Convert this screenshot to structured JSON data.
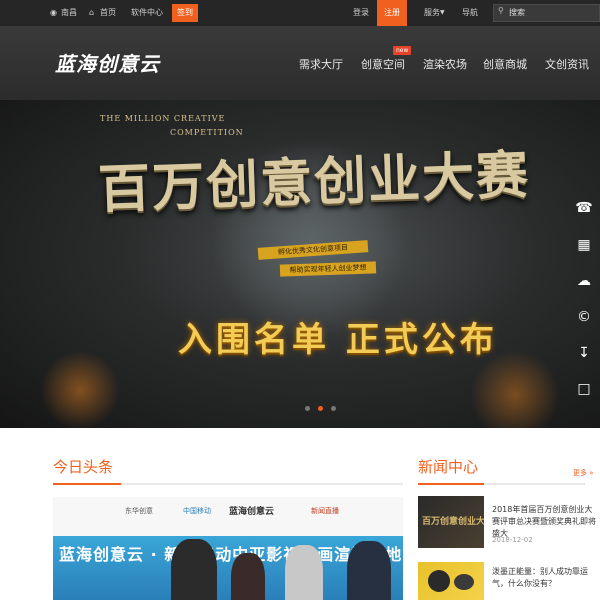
{
  "topbar": {
    "location": "南昌",
    "home": "首页",
    "software": "软件中心",
    "signin": "签到",
    "login": "登录",
    "register": "注册",
    "service": "服务",
    "nav": "导航",
    "search_placeholder": "搜索"
  },
  "header": {
    "logo": "蓝海创意云",
    "nav_items": [
      "需求大厅",
      "创意空间",
      "渲染农场",
      "创意商城",
      "文创资讯"
    ],
    "new_badge": "new"
  },
  "hero": {
    "subtitle_line1": "THE MILLION CREATIVE",
    "subtitle_line2": "COMPETITION",
    "title": "百万创意创业大赛",
    "ribbon1": "孵化优秀文化创意项目",
    "ribbon2": "帮助实现年轻人创业梦想",
    "announce": "入围名单 正式公布",
    "slides": 3,
    "active_slide": 1
  },
  "sidebar": {
    "icons": [
      "headset-icon",
      "qrcode-icon",
      "cloud-upload-icon",
      "copyright-icon",
      "download-icon",
      "monitor-icon"
    ]
  },
  "today": {
    "title": "今日头条",
    "banner_logos": [
      "东华创意",
      "中国移动",
      "蓝海创意云",
      "新闻直播"
    ],
    "banner_text": "蓝海创意云 · 新疆移动中亚影视动画渲染基地"
  },
  "news_center": {
    "title": "新闻中心",
    "more": "更多 »",
    "items": [
      {
        "title": "2018年首届百万创意创业大赛评审总决赛暨颁奖典礼即将盛大",
        "date": "2018-12-02"
      },
      {
        "title": "泼墨正能量：别人成功靠运气，什么你没有？",
        "date": ""
      }
    ]
  },
  "colors": {
    "accent": "#f0601f",
    "topbar_bg": "#262626",
    "header_bg": "#333333",
    "gold": "#f2cc55"
  }
}
